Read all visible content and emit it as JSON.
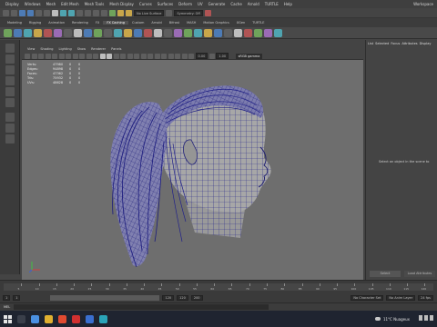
{
  "menubar": {
    "items": [
      "Display",
      "Windows",
      "Mesh",
      "Edit Mesh",
      "Mesh Tools",
      "Mesh Display",
      "Curves",
      "Surfaces",
      "Deform",
      "UV",
      "Generate",
      "Cache",
      "Arnold",
      "TURTLE",
      "Help"
    ],
    "workspace": "Workspace"
  },
  "status": {
    "no_live": "No Live Surface",
    "symmetry": "Symmetry: Off"
  },
  "shelf_tabs": [
    "Modeling",
    "Rigging",
    "Animation",
    "Rendering",
    "FX",
    "FX Caching",
    "Custom",
    "Arnold",
    "Bifrost",
    "MASH",
    "Motion Graphics",
    "XGen",
    "TURTLE"
  ],
  "panel_menu": [
    "View",
    "Shading",
    "Lighting",
    "Show",
    "Renderer",
    "Panels"
  ],
  "panel_tools": {
    "exposure": "0.00",
    "gamma": "1.00",
    "colorspace": "sRGB gamma"
  },
  "hud": {
    "rows": [
      {
        "label": "Verts:",
        "a": "47980",
        "b": "0",
        "c": "0"
      },
      {
        "label": "Edges:",
        "a": "94898",
        "b": "0",
        "c": "0"
      },
      {
        "label": "Faces:",
        "a": "47362",
        "b": "0",
        "c": "0"
      },
      {
        "label": "Tris:",
        "a": "75932",
        "b": "0",
        "c": "0"
      },
      {
        "label": "UVs:",
        "a": "48628",
        "b": "0",
        "c": "0"
      }
    ]
  },
  "right_panel": {
    "tabs": [
      "List",
      "Selected",
      "Focus",
      "Attributes",
      "Display"
    ],
    "message": "Select an object in the scene to",
    "btn_left": "Select",
    "btn_right": "Load Attributes"
  },
  "timeline": {
    "ticks": [
      "5",
      "10",
      "15",
      "20",
      "25",
      "30",
      "35",
      "40",
      "45",
      "50",
      "55",
      "60",
      "65",
      "70",
      "75",
      "80",
      "85",
      "90",
      "95",
      "100",
      "105",
      "110",
      "115",
      "120"
    ]
  },
  "range": {
    "start": "1",
    "current": "1",
    "end_a": "120",
    "end_b": "120",
    "end_c": "200",
    "character_set": "No Character Set",
    "anim_layer": "No Anim Layer",
    "fps": "24 fps"
  },
  "cmdline": {
    "label": "MEL"
  },
  "taskbar": {
    "weather": "11°C  Nuageux"
  }
}
